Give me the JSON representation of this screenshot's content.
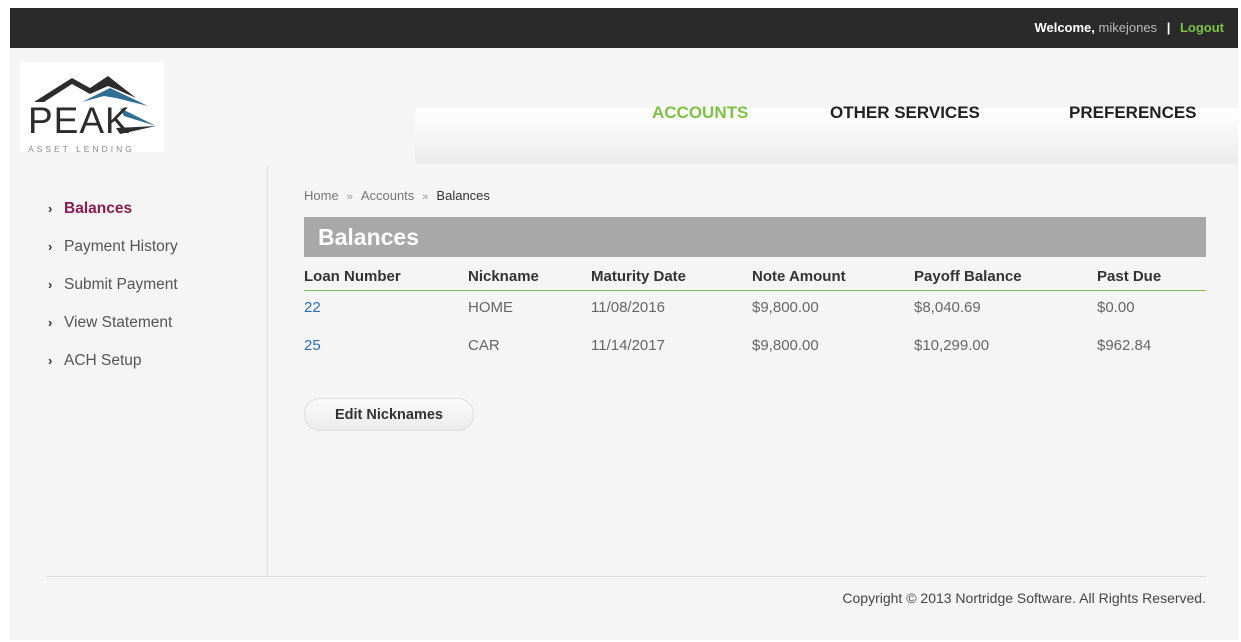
{
  "topbar": {
    "welcome_label": "Welcome,",
    "username": "mikejones",
    "separator": "|",
    "logout_label": "Logout"
  },
  "logo": {
    "name": "PEAK",
    "tagline": "ASSET LENDING"
  },
  "nav": {
    "items": [
      {
        "label": "ACCOUNTS",
        "active": true
      },
      {
        "label": "OTHER SERVICES",
        "active": false
      },
      {
        "label": "PREFERENCES",
        "active": false
      }
    ]
  },
  "sidebar": {
    "items": [
      {
        "label": "Balances",
        "active": true
      },
      {
        "label": "Payment History",
        "active": false
      },
      {
        "label": "Submit Payment",
        "active": false
      },
      {
        "label": "View Statement",
        "active": false
      },
      {
        "label": "ACH Setup",
        "active": false
      }
    ]
  },
  "breadcrumb": {
    "items": [
      "Home",
      "Accounts",
      "Balances"
    ],
    "separator": "»"
  },
  "main": {
    "title": "Balances",
    "table": {
      "columns": [
        "Loan Number",
        "Nickname",
        "Maturity Date",
        "Note Amount",
        "Payoff Balance",
        "Past Due"
      ],
      "rows": [
        [
          "22",
          "HOME",
          "11/08/2016",
          "$9,800.00",
          "$8,040.69",
          "$0.00"
        ],
        [
          "25",
          "CAR",
          "11/14/2017",
          "$9,800.00",
          "$10,299.00",
          "$962.84"
        ]
      ]
    },
    "edit_button_label": "Edit Nicknames"
  },
  "footer": {
    "copyright": "Copyright © 2013 Nortridge Software. All Rights Reserved."
  },
  "colors": {
    "accent_green": "#7dc242",
    "active_sidebar": "#8a1a4f",
    "link_blue": "#2a6db5",
    "topbar_bg": "#2a2a2a",
    "title_bg": "#a8a8a8"
  }
}
